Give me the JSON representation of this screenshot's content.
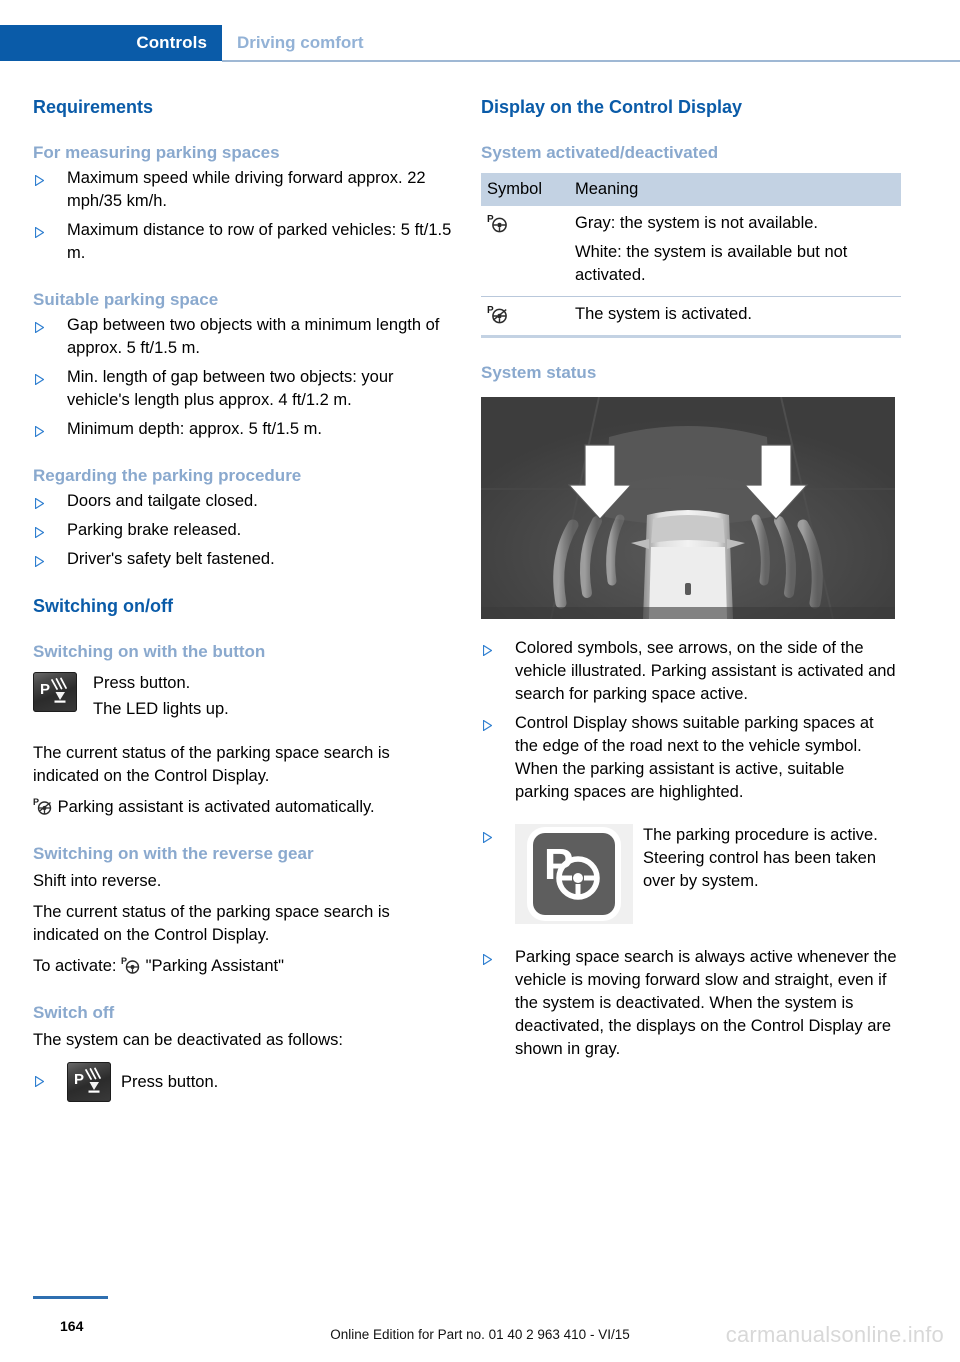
{
  "header": {
    "active_tab": "Controls",
    "inactive_tab": "Driving comfort",
    "active_bg": "#0a5ba8",
    "inactive_color": "#93b2d6"
  },
  "colors": {
    "heading_blue": "#0a5ba8",
    "subheading_blue": "#8aa9ce",
    "bullet_blue": "#2f7fd0",
    "table_header_bg": "#c3d2e3",
    "illustration_bg": "#3d3d3d"
  },
  "left_column": {
    "section_title": "Requirements",
    "groups": [
      {
        "subheading": "For measuring parking spaces",
        "bullets": [
          "Maximum speed while driving forward approx. 22 mph/35 km/h.",
          "Maximum distance to row of parked vehicles: 5 ft/1.5 m."
        ]
      },
      {
        "subheading": "Suitable parking space",
        "bullets": [
          "Gap between two objects with a minimum length of approx. 5 ft/1.5 m.",
          "Min. length of gap between two objects: your vehicle's length plus approx. 4 ft/1.2 m.",
          "Minimum depth: approx. 5 ft/1.5 m."
        ]
      },
      {
        "subheading": "Regarding the parking procedure",
        "bullets": [
          "Doors and tailgate closed.",
          "Parking brake released.",
          "Driver's safety belt fastened."
        ]
      }
    ],
    "switching_title": "Switching on/off",
    "switch_button": {
      "subheading": "Switching on with the button",
      "icon_name": "park-distance-button-icon",
      "line1": "Press button.",
      "line2": "The LED lights up.",
      "para": "The current status of the parking space search is indicated on the Control Display.",
      "auto_line": "Parking assistant is activated automatically."
    },
    "switch_reverse": {
      "subheading": "Switching on with the reverse gear",
      "line1": "Shift into reverse.",
      "para": "The current status of the parking space search is indicated on the Control Display.",
      "activate_prefix": "To activate:",
      "activate_value": "\"Parking Assistant\""
    },
    "switch_off": {
      "subheading": "Switch off",
      "intro": "The system can be deactivated as follows:",
      "bullet_label": "Press button."
    }
  },
  "right_column": {
    "section_title": "Display on the Control Display",
    "table_subheading": "System activated/deactivated",
    "table": {
      "columns": [
        "Symbol",
        "Meaning"
      ],
      "rows": [
        {
          "symbol_name": "parking-steering-wheel-icon",
          "meanings": [
            "Gray: the system is not available.",
            "White: the system is available but not activated."
          ]
        },
        {
          "symbol_name": "parking-steering-wheel-active-icon",
          "meanings": [
            "The system is activated."
          ]
        }
      ]
    },
    "status_subheading": "System status",
    "illustration_name": "top-down-vehicle-parking-sensors-illustration",
    "bullets": [
      "Colored symbols, see arrows, on the side of the vehicle illustrated. Parking assistant is activated and search for parking space active.",
      "Control Display shows suitable parking spaces at the edge of the road next to the vehicle symbol. When the parking assistant is active, suitable parking spaces are highlighted."
    ],
    "icon_bullet": {
      "icon_name": "parking-assistant-active-icon",
      "text": "The parking procedure is active. Steering control has been taken over by system."
    },
    "final_bullet": "Parking space search is always active whenever the vehicle is moving forward slow and straight, even if the system is deactivated. When the system is deactivated, the displays on the Control Display are shown in gray."
  },
  "footer": {
    "page_number": "164",
    "edition_text": "Online Edition for Part no. 01 40 2 963 410 - VI/15",
    "watermark": "carmanualsonline.info"
  }
}
